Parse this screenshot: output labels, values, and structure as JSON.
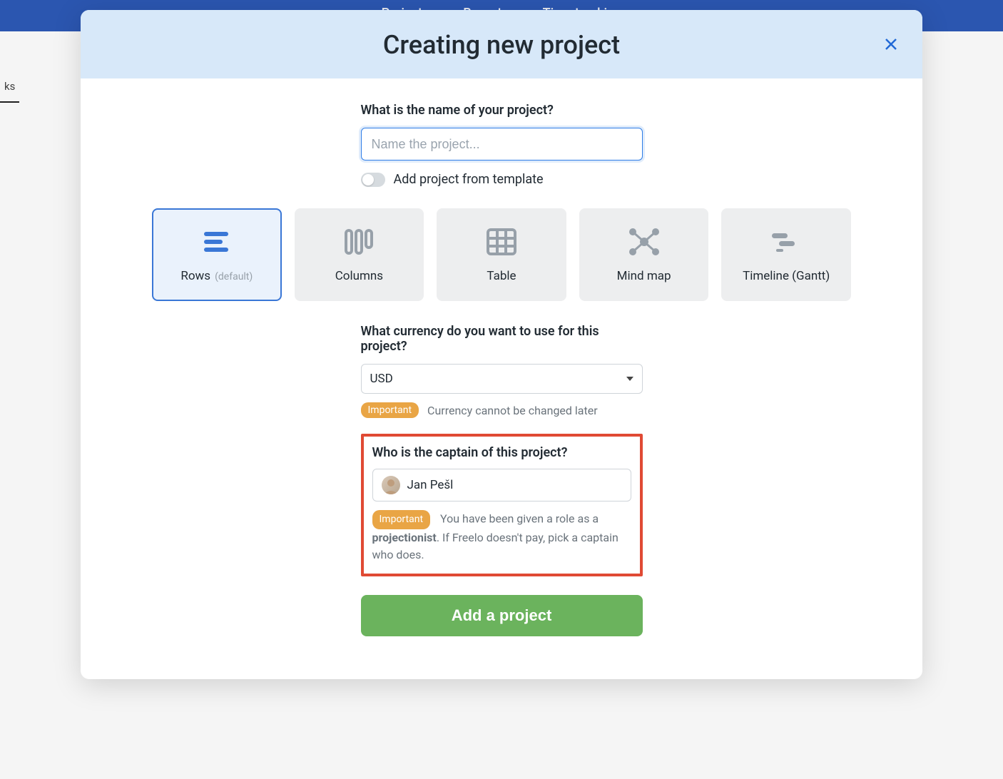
{
  "bg_nav": {
    "projects": "Projects",
    "reports": "Reports",
    "time": "Time tracking"
  },
  "bg_tab": "ks",
  "modal": {
    "title": "Creating new project",
    "name_label": "What is the name of your project?",
    "name_placeholder": "Name the project...",
    "template_toggle": "Add project from template",
    "views": [
      {
        "label": "Rows",
        "suffix": "(default)",
        "selected": true
      },
      {
        "label": "Columns"
      },
      {
        "label": "Table"
      },
      {
        "label": "Mind map"
      },
      {
        "label": "Timeline (Gantt)"
      }
    ],
    "currency_label": "What currency do you want to use for this project?",
    "currency_value": "USD",
    "important_badge": "Important",
    "currency_hint": "Currency cannot be changed later",
    "captain_label": "Who is the captain of this project?",
    "captain_value": "Jan Pešl",
    "captain_note_1": "You have been given a role as a ",
    "captain_note_bold": "projectionist",
    "captain_note_2": ". If Freelo doesn't pay, pick a captain who does.",
    "submit": "Add a project"
  }
}
